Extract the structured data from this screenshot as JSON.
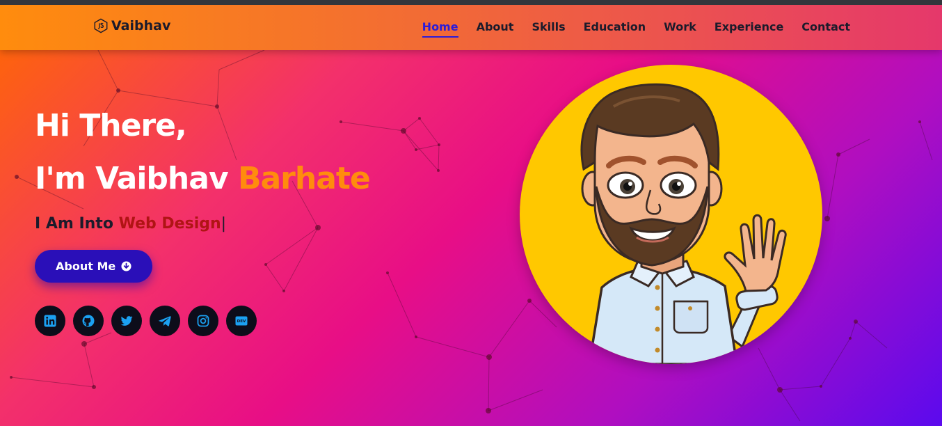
{
  "header": {
    "logo_text": "Vaibhav",
    "logo_icon": "js-hex-icon",
    "nav": [
      {
        "label": "Home",
        "active": true
      },
      {
        "label": "About",
        "active": false
      },
      {
        "label": "Skills",
        "active": false
      },
      {
        "label": "Education",
        "active": false
      },
      {
        "label": "Work",
        "active": false
      },
      {
        "label": "Experience",
        "active": false
      },
      {
        "label": "Contact",
        "active": false
      }
    ]
  },
  "hero": {
    "greeting": "Hi There,",
    "intro": "I'm Vaibhav",
    "name_accent": "Barhate",
    "tagline_prefix": "I Am Into",
    "tagline_typed": "Web Design",
    "caret": "|",
    "about_button": "About Me",
    "socials": [
      "linkedin-icon",
      "github-icon",
      "twitter-icon",
      "telegram-icon",
      "instagram-icon",
      "dev-icon"
    ]
  },
  "dev_badge_text": "DEV",
  "colors": {
    "accent": "#ff8c0d",
    "nav_active": "#2c1cd8",
    "button": "#2a0fb8",
    "typed_text": "#b01414",
    "social_icon": "#1ba1f2",
    "avatar_bg": "#ffc800"
  }
}
